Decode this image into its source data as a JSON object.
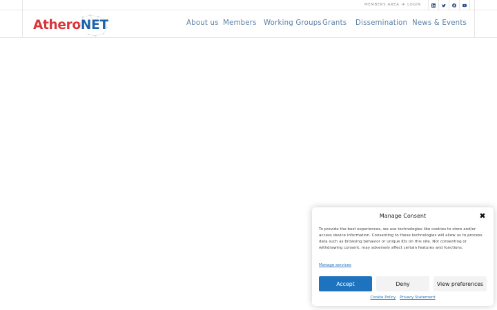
{
  "topbar": {
    "members_area_label": "MEMBERS AREA",
    "login_label": "LOGIN",
    "social": [
      {
        "name": "linkedin-icon"
      },
      {
        "name": "twitter-icon"
      },
      {
        "name": "facebook-icon"
      },
      {
        "name": "youtube-icon"
      }
    ]
  },
  "header": {
    "logo": {
      "part1": "Athero",
      "part2": "NET"
    },
    "nav": [
      {
        "label": "About us"
      },
      {
        "label": "Members"
      },
      {
        "label": "Working Groups"
      },
      {
        "label": "Grants"
      },
      {
        "label": "Dissemination"
      },
      {
        "label": "News & Events"
      }
    ]
  },
  "consent": {
    "title": "Manage Consent",
    "close_icon": "close-icon",
    "text": "To provide the best experiences, we use technologies like cookies to store and/or access device information. Consenting to these technologies will allow us to process data such as browsing behavior or unique IDs on this site. Not consenting or withdrawing consent, may adversely affect certain features and functions.",
    "manage_services": "Manage services",
    "accept_label": "Accept",
    "deny_label": "Deny",
    "preferences_label": "View preferences",
    "cookie_policy": "Cookie Policy",
    "privacy_statement": "Privacy Statement"
  },
  "colors": {
    "accent": "#1e73be",
    "logo_red": "#d9343b",
    "logo_blue": "#1f62a8",
    "nav_text": "#5a7fa6"
  }
}
